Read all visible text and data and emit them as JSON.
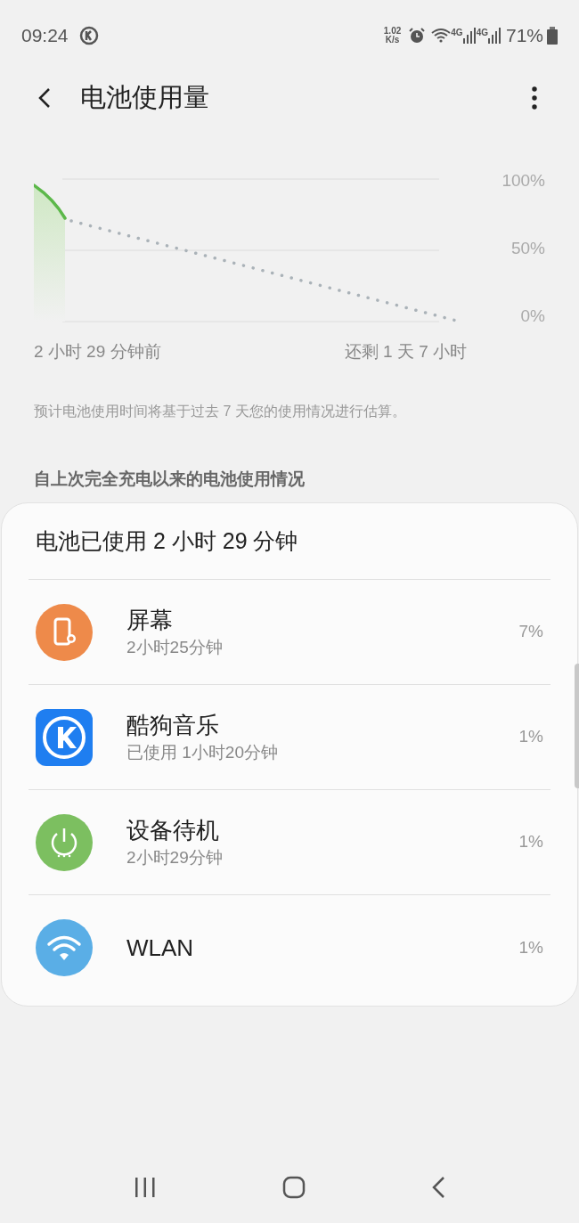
{
  "status_bar": {
    "time": "09:24",
    "speed_value": "1.02",
    "speed_unit": "K/s",
    "network_1": "4G",
    "network_2": "4G",
    "battery": "71%"
  },
  "header": {
    "title": "电池使用量"
  },
  "chart": {
    "y_labels": [
      "100%",
      "50%",
      "0%"
    ],
    "start_label": "2 小时 29 分钟前",
    "end_label": "还剩 1 天 7 小时"
  },
  "note": "预计电池使用时间将基于过去 7 天您的使用情况进行估算。",
  "section_title": "自上次完全充电以来的电池使用情况",
  "usage": {
    "summary": "电池已使用 2 小时 29 分钟",
    "items": [
      {
        "kind": "screen",
        "color": "#ee8a4a",
        "name": "屏幕",
        "detail": "2小时25分钟",
        "percent": "7%"
      },
      {
        "kind": "music",
        "color": "#1f7ef0",
        "name": "酷狗音乐",
        "detail": "已使用 1小时20分钟",
        "percent": "1%"
      },
      {
        "kind": "standby",
        "color": "#7cbf60",
        "name": "设备待机",
        "detail": "2小时29分钟",
        "percent": "1%"
      },
      {
        "kind": "wifi",
        "color": "#5aaee6",
        "name": "WLAN",
        "percent": "1%"
      }
    ]
  }
}
